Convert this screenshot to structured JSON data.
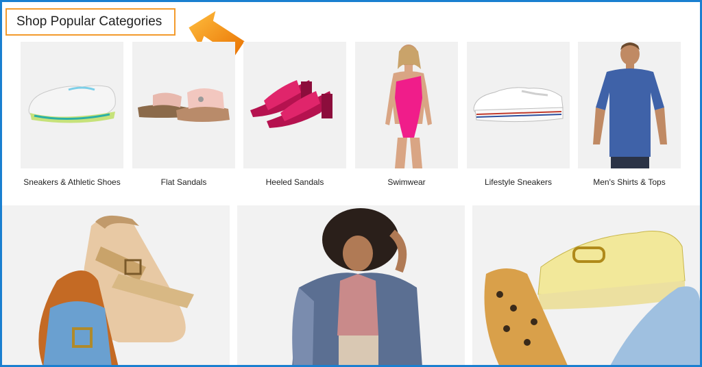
{
  "section": {
    "title": "Shop Popular Categories"
  },
  "categories": [
    {
      "label": "Sneakers & Athletic Shoes",
      "icon": "sneaker-icon"
    },
    {
      "label": "Flat Sandals",
      "icon": "flat-sandal-icon"
    },
    {
      "label": "Heeled Sandals",
      "icon": "heeled-sandal-icon"
    },
    {
      "label": "Swimwear",
      "icon": "swimsuit-icon"
    },
    {
      "label": "Lifestyle Sneakers",
      "icon": "canvas-sneaker-icon"
    },
    {
      "label": "Men's Shirts & Tops",
      "icon": "tshirt-icon"
    }
  ],
  "banners": [
    {
      "name": "sandals-banner"
    },
    {
      "name": "women-fashion-banner"
    },
    {
      "name": "loafers-banner"
    }
  ],
  "colors": {
    "frame": "#1a7fd0",
    "heading_border": "#f39a2b",
    "arrow": "#f08a12",
    "tile_bg": "#f1f1f1"
  }
}
